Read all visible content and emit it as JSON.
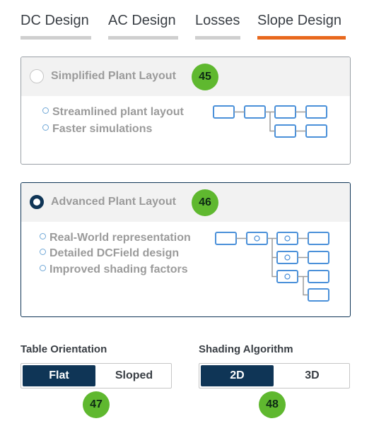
{
  "tabs": [
    {
      "label": "DC Design",
      "active": false
    },
    {
      "label": "AC Design",
      "active": false
    },
    {
      "label": "Losses",
      "active": false
    },
    {
      "label": "Slope Design",
      "active": true
    }
  ],
  "accent_color": "#e8681d",
  "primary_color": "#0f3556",
  "badge_color": "#5fb82f",
  "layouts": [
    {
      "title": "Simplified Plant Layout",
      "selected": false,
      "badge": "45",
      "features": [
        "Streamlined plant layout",
        "Faster simulations"
      ]
    },
    {
      "title": "Advanced Plant Layout",
      "selected": true,
      "badge": "46",
      "features": [
        "Real-World representation",
        "Detailed DCField design",
        "Improved shading factors"
      ]
    }
  ],
  "table_orientation": {
    "label": "Table Orientation",
    "options": [
      "Flat",
      "Sloped"
    ],
    "selected": "Flat",
    "badge": "47"
  },
  "shading_algorithm": {
    "label": "Shading Algorithm",
    "options": [
      "2D",
      "3D"
    ],
    "selected": "2D",
    "badge": "48"
  }
}
